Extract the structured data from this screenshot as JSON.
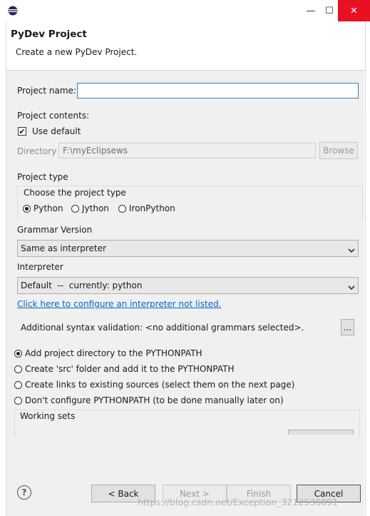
{
  "window": {
    "minimize_glyph": "—",
    "maximize_glyph": "☐",
    "close_glyph": "✕"
  },
  "header": {
    "title": "PyDev Project",
    "subtitle": "Create a new PyDev Project."
  },
  "form": {
    "project_name_label": "Project name:",
    "project_name_value": "",
    "project_contents_label": "Project contents:",
    "use_default_label": "Use default",
    "use_default_checked": true,
    "directory_label": "Directory",
    "directory_value": "F:\\myEclipsews",
    "browse_label": "Browse",
    "project_type_label": "Project type",
    "choose_type_label": "Choose the project type",
    "types": [
      {
        "label": "Python",
        "selected": true
      },
      {
        "label": "Jython",
        "selected": false
      },
      {
        "label": "IronPython",
        "selected": false
      }
    ],
    "grammar_label": "Grammar Version",
    "grammar_value": "Same as interpreter",
    "interpreter_label": "Interpreter",
    "interpreter_value": "Default  --  currently: python",
    "configure_link": "Click here to configure an interpreter not listed.",
    "syntax_validation_label": "Additional syntax validation: <no additional grammars selected>.",
    "syntax_button_label": "...",
    "pythonpath_options": [
      {
        "label": "Add project directory to the PYTHONPATH",
        "selected": true
      },
      {
        "label": "Create 'src' folder and add it to the PYTHONPATH",
        "selected": false
      },
      {
        "label": "Create links to existing sources (select them on the next page)",
        "selected": false
      },
      {
        "label": "Don't configure PYTHONPATH (to be done manually later on)",
        "selected": false
      }
    ],
    "working_sets_label": "Working sets"
  },
  "footer": {
    "help_glyph": "?",
    "back_label": "< Back",
    "next_label": "Next >",
    "finish_label": "Finish",
    "cancel_label": "Cancel"
  },
  "watermark": "https://blog.csdn.net/Exception_3212536091",
  "colors": {
    "close_red": "#e81123",
    "link_blue": "#0066cc",
    "focus_blue": "#3c7fb1"
  }
}
